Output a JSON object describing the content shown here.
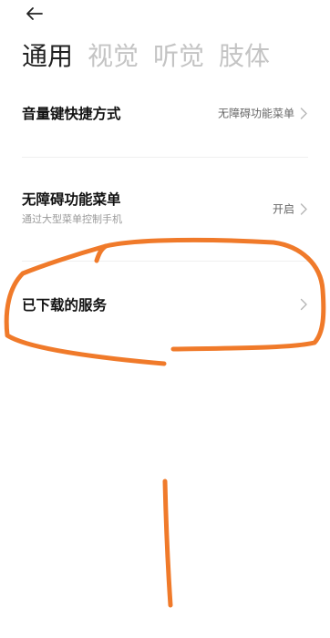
{
  "header": {
    "back_icon": "arrow-left-icon"
  },
  "tabs": [
    {
      "label": "通用",
      "active": true
    },
    {
      "label": "视觉",
      "active": false
    },
    {
      "label": "听觉",
      "active": false
    },
    {
      "label": "肢体",
      "active": false
    }
  ],
  "settings": [
    {
      "title": "音量键快捷方式",
      "subtitle": "",
      "value": "无障碍功能菜单"
    },
    {
      "title": "无障碍功能菜单",
      "subtitle": "通过大型菜单控制手机",
      "value": "开启"
    },
    {
      "title": "已下载的服务",
      "subtitle": "",
      "value": ""
    }
  ],
  "annotation": {
    "color": "#f07a2a"
  }
}
